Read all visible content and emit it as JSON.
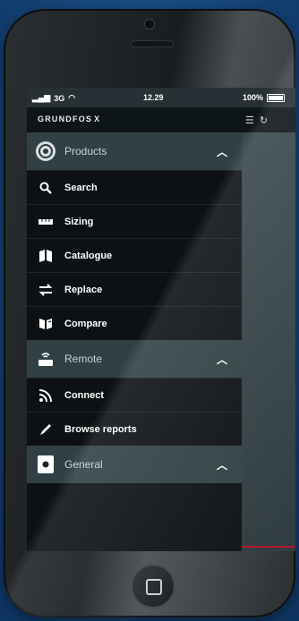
{
  "status_bar": {
    "carrier": "3G",
    "time": "12.29",
    "battery": "100%"
  },
  "app_bar": {
    "brand": "GRUNDFOS",
    "brand_mark": "X"
  },
  "menu": {
    "sections": [
      {
        "label": "Products",
        "icon": "products-circle-icon",
        "items": [
          {
            "label": "Search",
            "icon": "search-icon"
          },
          {
            "label": "Sizing",
            "icon": "sizing-icon"
          },
          {
            "label": "Catalogue",
            "icon": "catalogue-icon"
          },
          {
            "label": "Replace",
            "icon": "replace-icon"
          },
          {
            "label": "Compare",
            "icon": "compare-icon"
          }
        ]
      },
      {
        "label": "Remote",
        "icon": "remote-icon",
        "items": [
          {
            "label": "Connect",
            "icon": "rss-icon"
          },
          {
            "label": "Browse reports",
            "icon": "pencil-icon"
          }
        ]
      },
      {
        "label": "General",
        "icon": "general-icon",
        "items": []
      }
    ]
  },
  "colors": {
    "accent_red": "#b5122b",
    "section_bg": "#314044",
    "menu_bg": "#0d1114"
  }
}
